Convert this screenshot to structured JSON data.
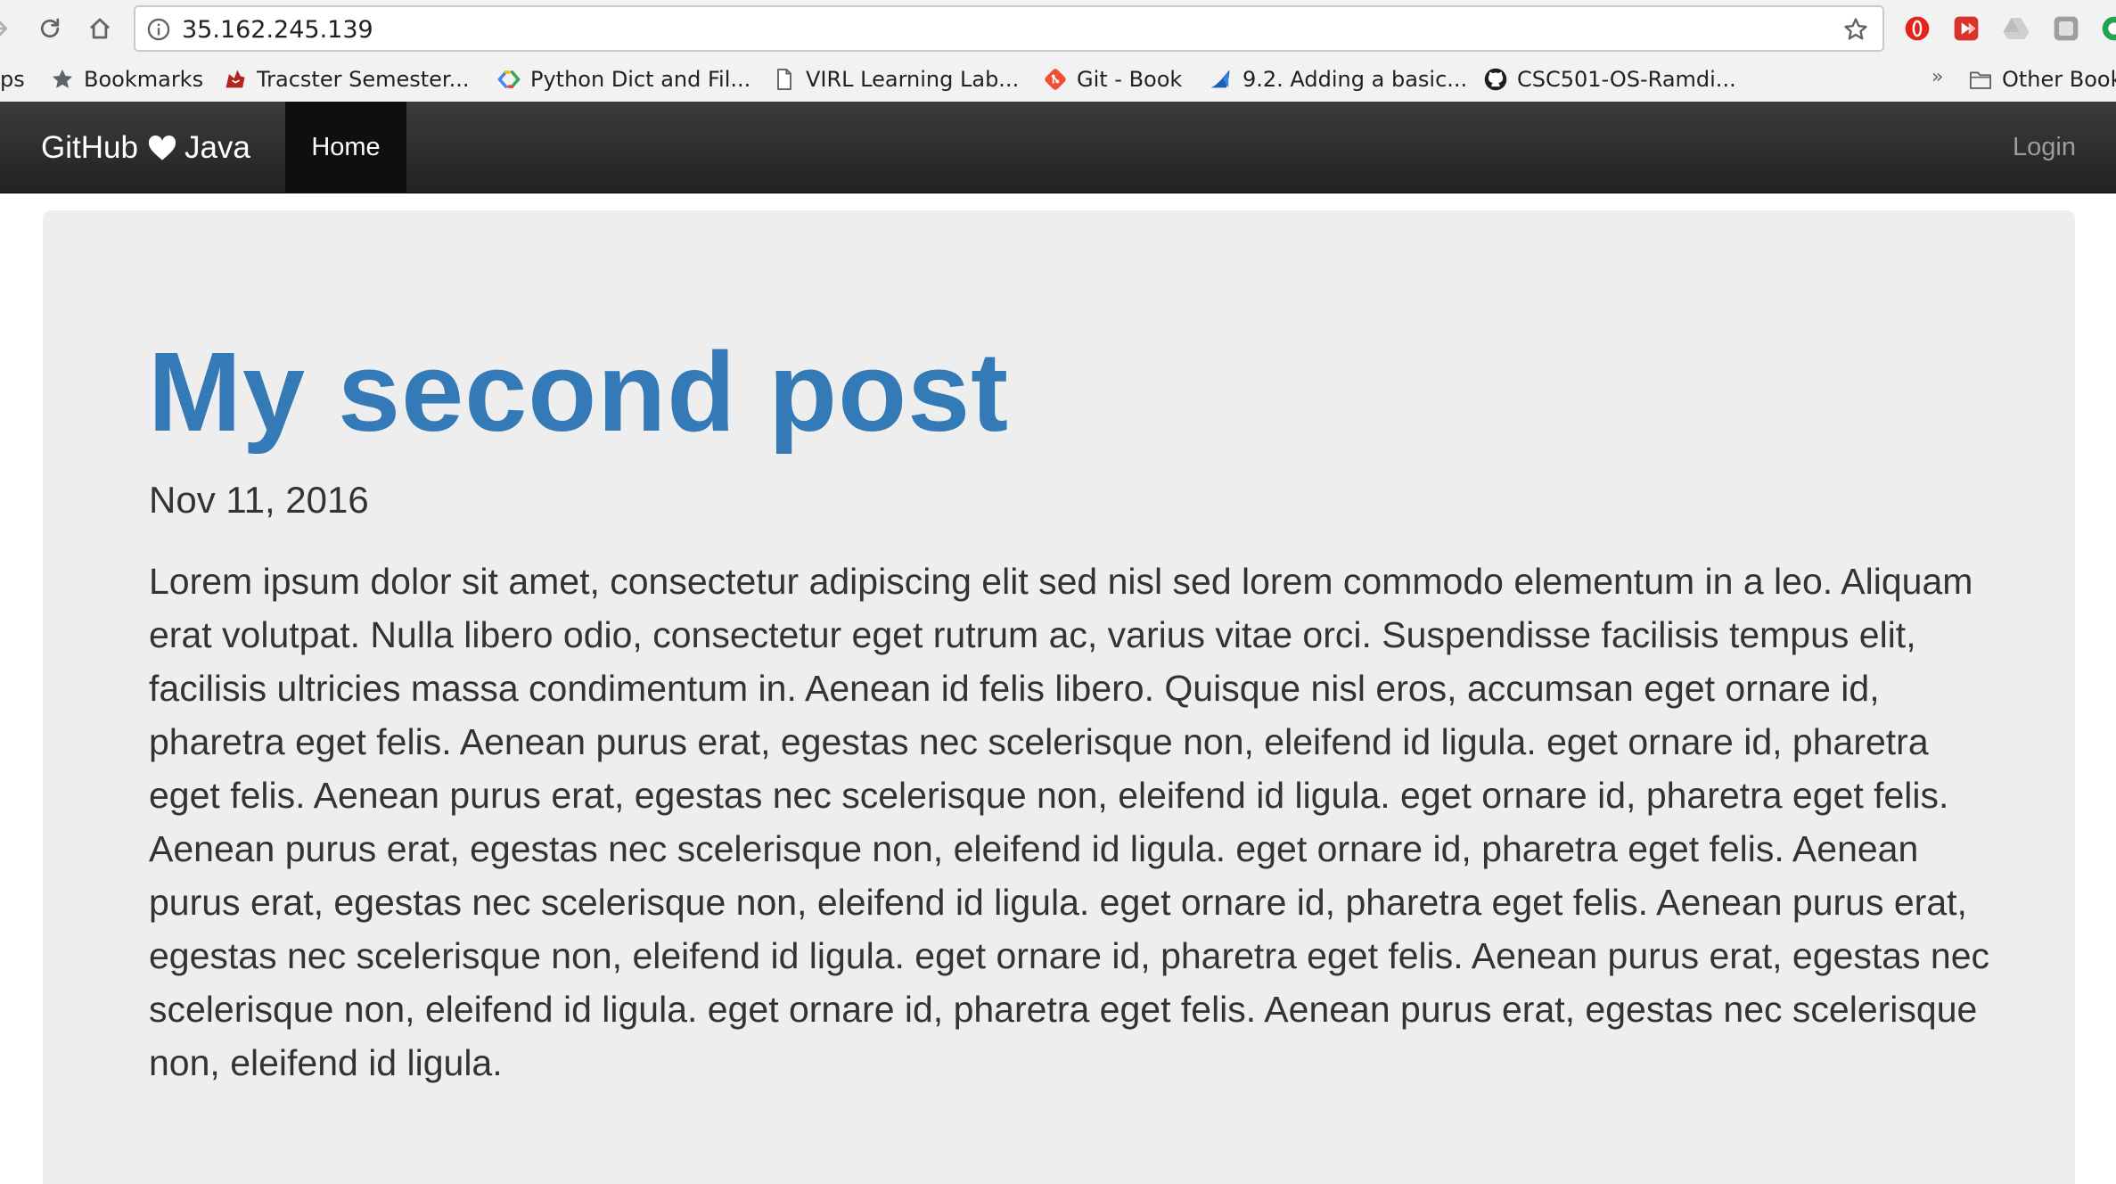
{
  "browser": {
    "url": "35.162.245.139",
    "bookmarks_bar": {
      "apps_label": "ps",
      "items": [
        {
          "label": "Bookmarks"
        },
        {
          "label": "Tracster Semester..."
        },
        {
          "label": "Python Dict and Fil..."
        },
        {
          "label": "VIRL Learning Lab..."
        },
        {
          "label": "Git - Book"
        },
        {
          "label": "9.2. Adding a basic..."
        },
        {
          "label": "CSC501-OS-Ramdi..."
        }
      ],
      "overflow_label": "»",
      "other_label": "Other Book"
    }
  },
  "navbar": {
    "brand_left": "GitHub",
    "brand_right": "Java",
    "home_label": "Home",
    "login_label": "Login"
  },
  "post": {
    "title": "My second post",
    "date": "Nov 11, 2016",
    "body": "Lorem ipsum dolor sit amet, consectetur adipiscing elit sed nisl sed lorem commodo elementum in a leo. Aliquam erat volutpat. Nulla libero odio, consectetur eget rutrum ac, varius vitae orci. Suspendisse facilisis tempus elit, facilisis ultricies massa condimentum in. Aenean id felis libero. Quisque nisl eros, accumsan eget ornare id, pharetra eget felis. Aenean purus erat, egestas nec scelerisque non, eleifend id ligula. eget ornare id, pharetra eget felis. Aenean purus erat, egestas nec scelerisque non, eleifend id ligula. eget ornare id, pharetra eget felis. Aenean purus erat, egestas nec scelerisque non, eleifend id ligula. eget ornare id, pharetra eget felis. Aenean purus erat, egestas nec scelerisque non, eleifend id ligula. eget ornare id, pharetra eget felis. Aenean purus erat, egestas nec scelerisque non, eleifend id ligula. eget ornare id, pharetra eget felis. Aenean purus erat, egestas nec scelerisque non, eleifend id ligula. eget ornare id, pharetra eget felis. Aenean purus erat, egestas nec scelerisque non, eleifend id ligula."
  },
  "colors": {
    "link_blue": "#337ab7",
    "navbar_dark": "#222222",
    "jumbotron_bg": "#eeeeee"
  }
}
